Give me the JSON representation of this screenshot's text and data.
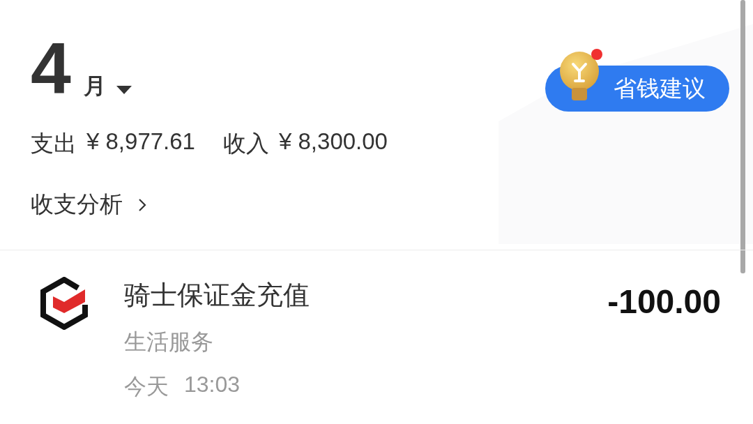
{
  "header": {
    "month": "4",
    "month_unit": "月"
  },
  "summary": {
    "expense_label": "支出",
    "expense_amount": "¥ 8,977.61",
    "income_label": "收入",
    "income_amount": "¥ 8,300.00"
  },
  "analysis_link": {
    "label": "收支分析"
  },
  "savings_button": {
    "label": "省钱建议",
    "has_notification": true
  },
  "transactions": [
    {
      "title": "骑士保证金充值",
      "category": "生活服务",
      "day": "今天",
      "time": "13:03",
      "amount": "-100.00"
    }
  ]
}
